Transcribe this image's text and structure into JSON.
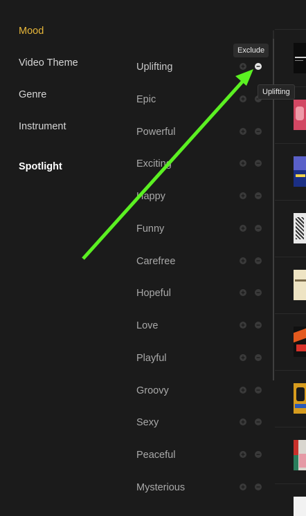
{
  "nav": {
    "items": [
      {
        "label": "Mood"
      },
      {
        "label": "Video Theme"
      },
      {
        "label": "Genre"
      },
      {
        "label": "Instrument"
      },
      {
        "label": "Spotlight"
      }
    ]
  },
  "moods": [
    {
      "label": "Uplifting"
    },
    {
      "label": "Epic"
    },
    {
      "label": "Powerful"
    },
    {
      "label": "Exciting"
    },
    {
      "label": "Happy"
    },
    {
      "label": "Funny"
    },
    {
      "label": "Carefree"
    },
    {
      "label": "Hopeful"
    },
    {
      "label": "Love"
    },
    {
      "label": "Playful"
    },
    {
      "label": "Groovy"
    },
    {
      "label": "Sexy"
    },
    {
      "label": "Peaceful"
    },
    {
      "label": "Mysterious"
    }
  ],
  "tooltips": {
    "exclude": "Exclude",
    "hovered_mood": "Uplifting"
  },
  "colors": {
    "background": "#1b1b1b",
    "active_nav": "#e8b73a",
    "annotation_arrow": "#5bf022"
  },
  "icons": {
    "include": "plus-circle-icon",
    "exclude": "minus-circle-icon"
  }
}
